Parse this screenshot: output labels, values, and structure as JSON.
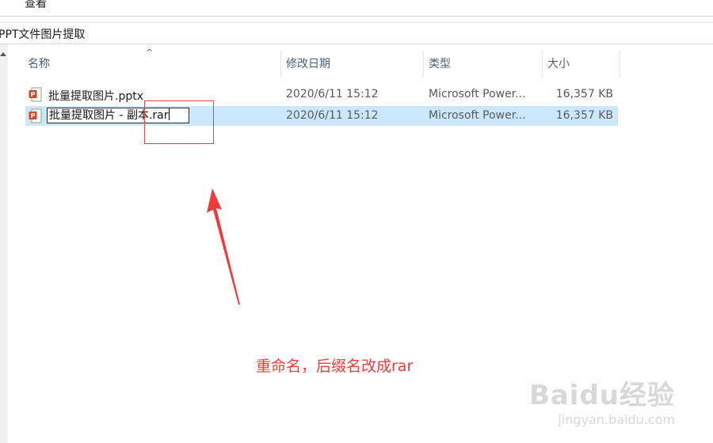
{
  "ribbon": {
    "active_tab": "查看"
  },
  "address_bar": {
    "path": "PPT文件图片提取"
  },
  "columns": {
    "name": "名称",
    "date": "修改日期",
    "type": "类型",
    "size": "大小"
  },
  "files": [
    {
      "name": "批量提取图片.pptx",
      "date": "2020/6/11 15:12",
      "type": "Microsoft Power...",
      "size": "16,357 KB",
      "icon": "powerpoint-icon"
    },
    {
      "name": "批量提取图片 - 副本.rar",
      "date": "2020/6/11 15:12",
      "type": "Microsoft Power...",
      "size": "16,357 KB",
      "icon": "powerpoint-icon",
      "selected": true,
      "renaming": true
    }
  ],
  "annotation": {
    "text": "重命名，后缀名改成rar",
    "color": "#e8413c"
  },
  "watermark": {
    "logo": "Baidu经验",
    "url": "jingyan.baidu.com"
  },
  "colors": {
    "selection": "#cce8ff",
    "header_text": "#4c607a",
    "annotation": "#e8413c"
  }
}
